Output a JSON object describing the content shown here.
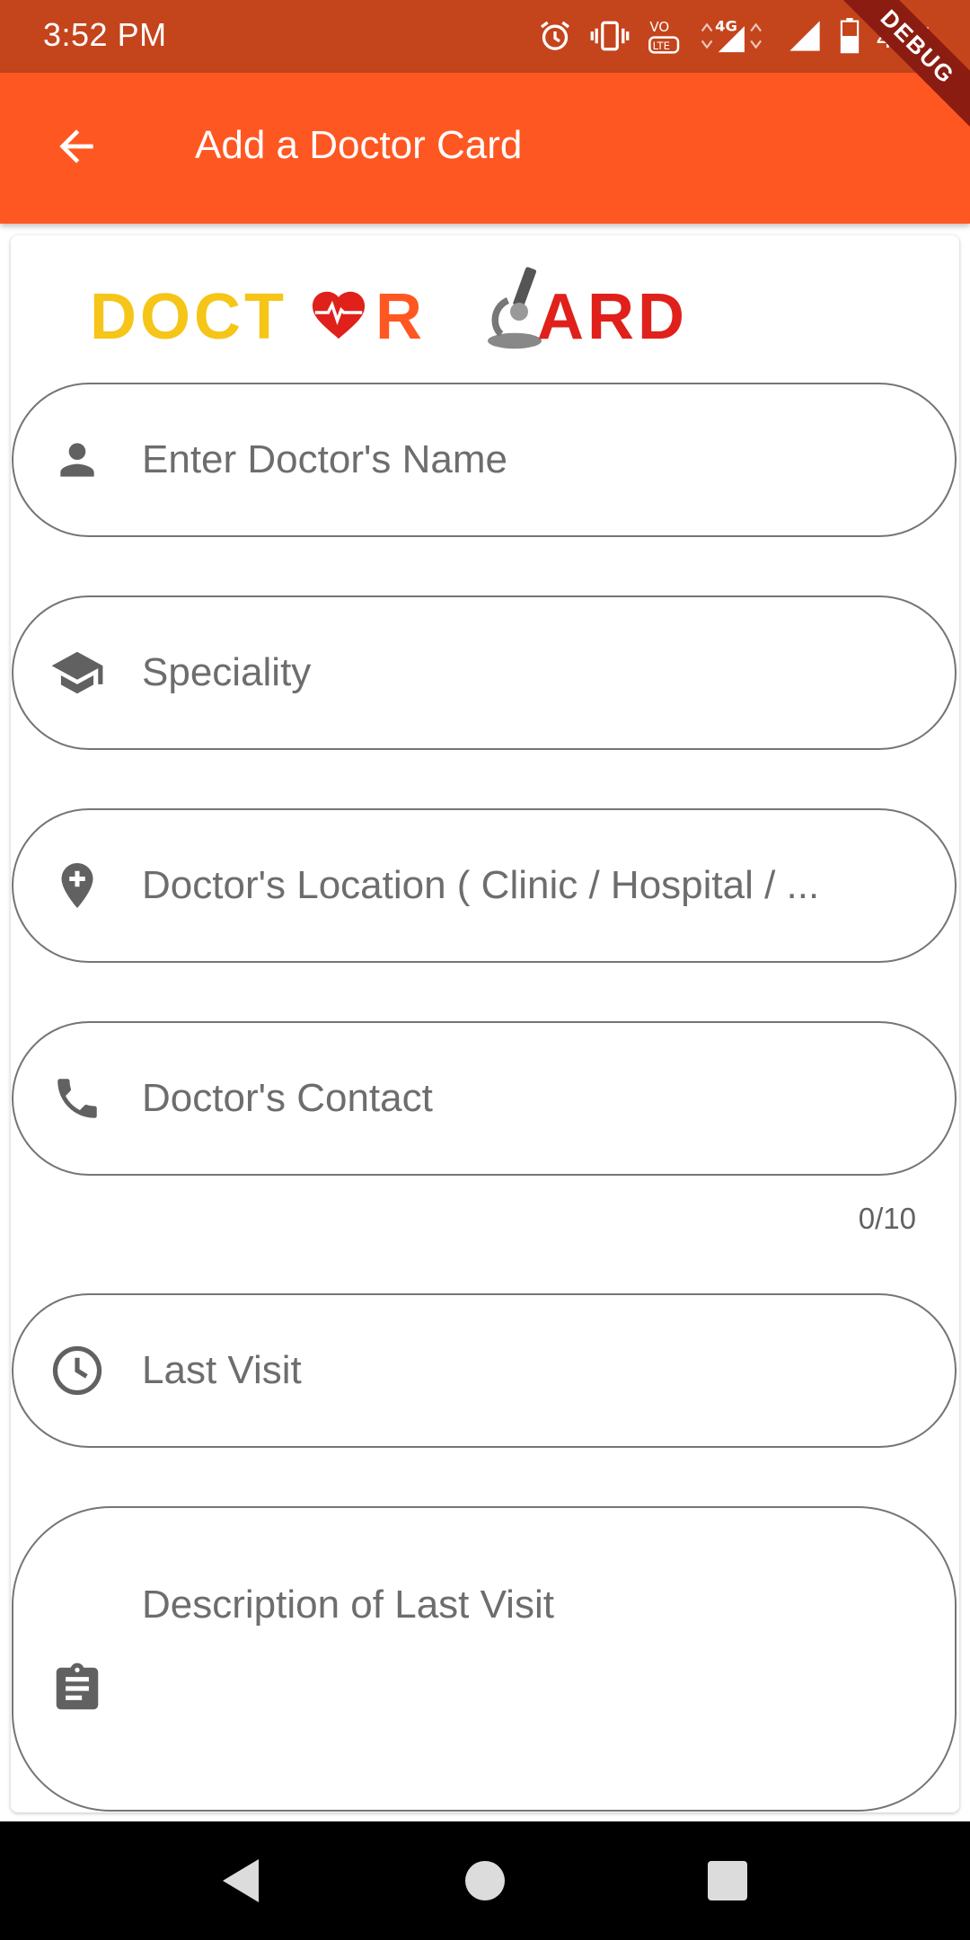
{
  "status_bar": {
    "time": "3:52 PM",
    "battery_percent": "47%",
    "network": "4G",
    "debug_label": "DEBUG"
  },
  "app_bar": {
    "back_icon": "arrow-back-icon",
    "title": "Add a Doctor Card"
  },
  "logo": {
    "word1_part1": "DOCT",
    "word1_part2": "R",
    "word2": "ARD",
    "colors": {
      "doctor": "#f5c518",
      "r": "#ff5722",
      "card": "#e0201b",
      "heart": "#e0201b"
    }
  },
  "form": {
    "fields": [
      {
        "icon": "person-icon",
        "placeholder": "Enter Doctor's Name"
      },
      {
        "icon": "school-icon",
        "placeholder": "Speciality"
      },
      {
        "icon": "location-plus-icon",
        "placeholder": "Doctor's Location ( Clinic / Hospital / ..."
      },
      {
        "icon": "phone-icon",
        "placeholder": "Doctor's Contact",
        "counter": "0/10"
      },
      {
        "icon": "clock-icon",
        "placeholder": "Last Visit"
      },
      {
        "icon": "clipboard-icon",
        "placeholder": "Description of Last Visit"
      }
    ]
  },
  "colors": {
    "status_bar": "#c4441c",
    "app_bar": "#ff5722",
    "field_border": "#757575",
    "icon": "#616161"
  }
}
